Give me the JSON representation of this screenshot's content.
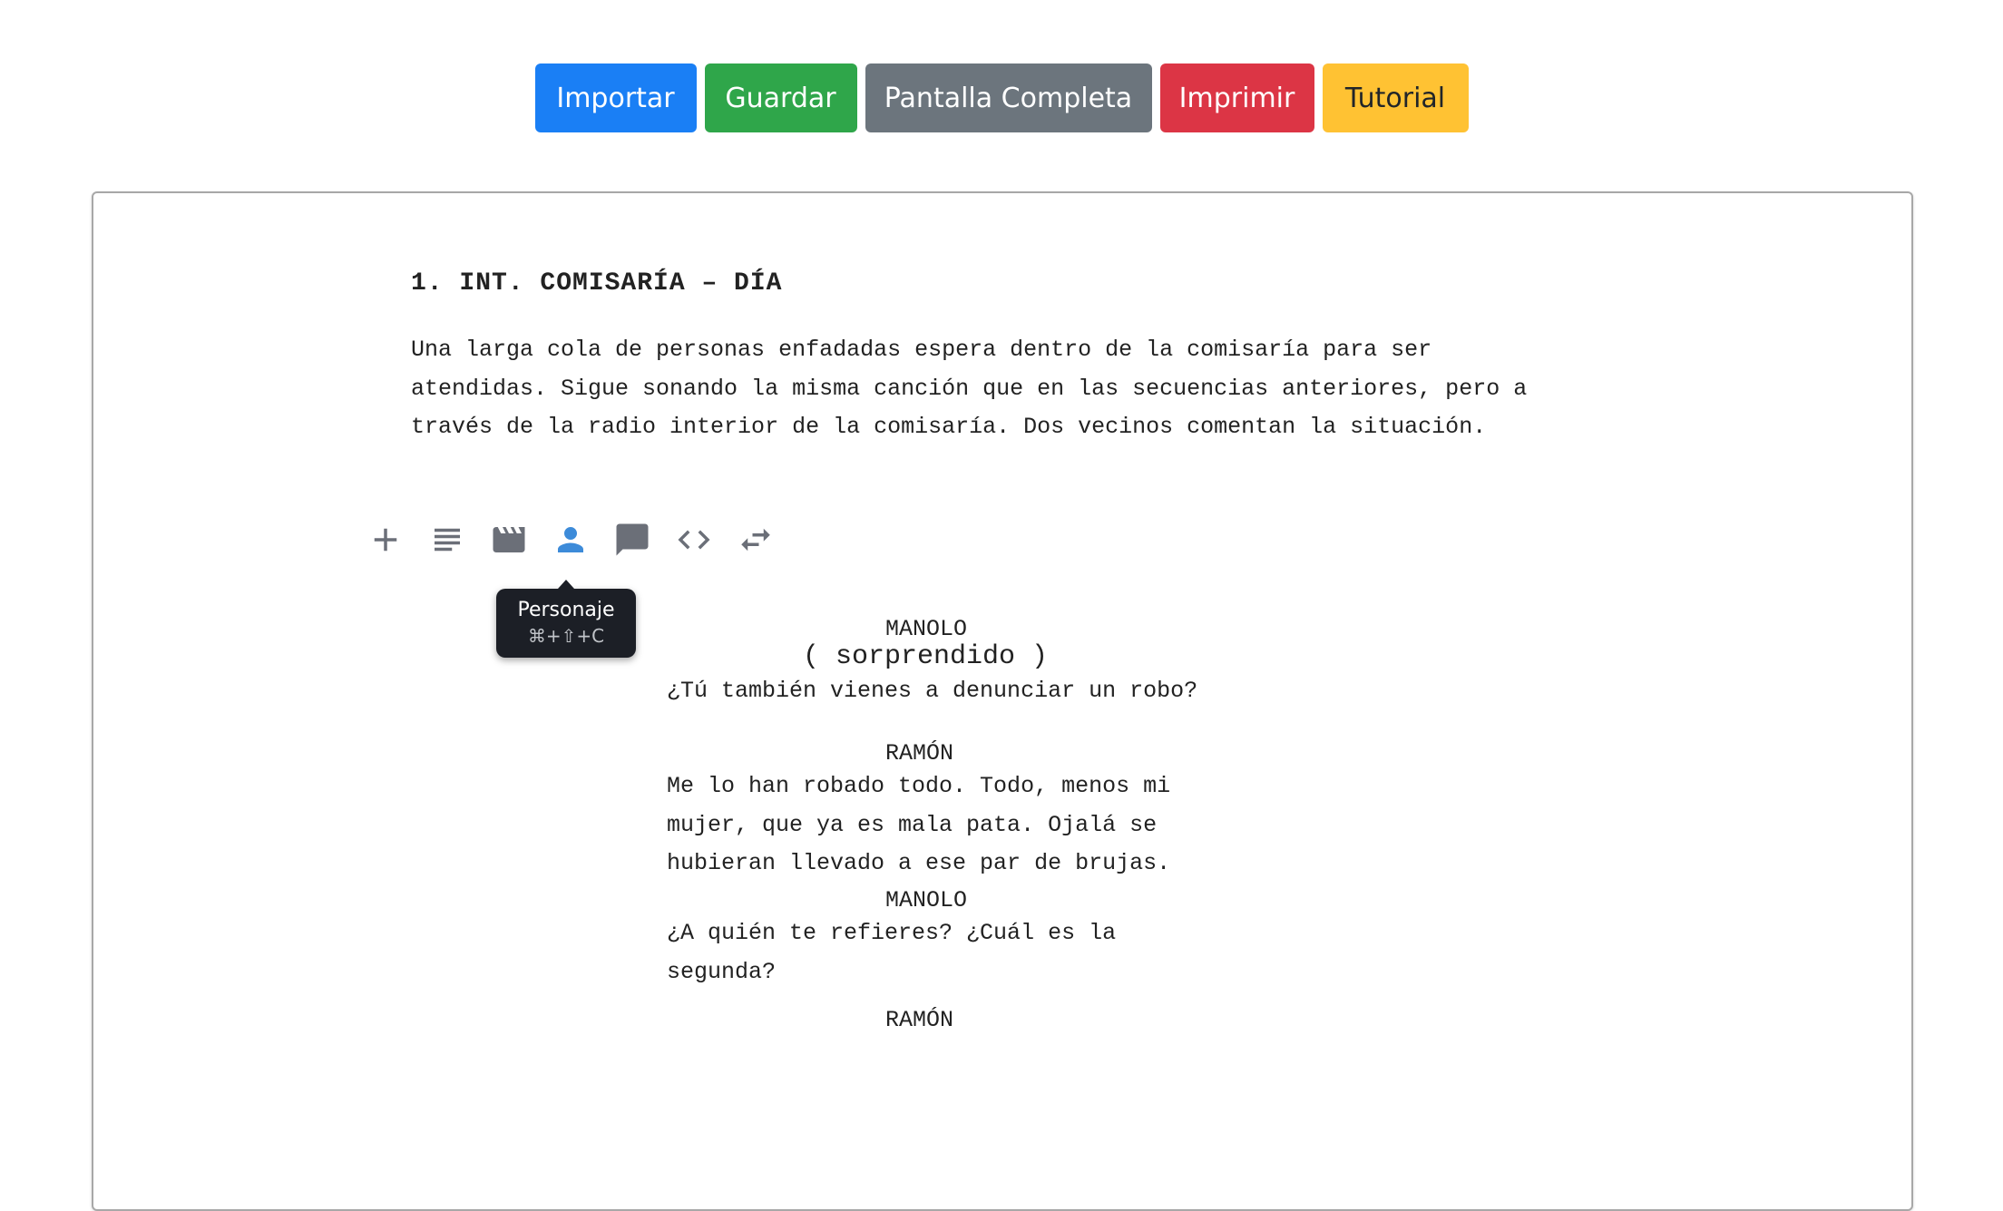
{
  "toolbar": {
    "import": "Importar",
    "save": "Guardar",
    "fullscreen": "Pantalla Completa",
    "print": "Imprimir",
    "tutorial": "Tutorial"
  },
  "script": {
    "scene_heading": "1. INT. COMISARÍA – DÍA",
    "action": "Una larga cola de personas enfadadas espera dentro de la comisaría para ser atendidas. Sigue sonando la misma canción que en las secuencias anteriores, pero a través de la radio interior de la comisaría. Dos vecinos comentan la situación.",
    "blocks": [
      {
        "character": "MANOLO",
        "parenthetical": "( sorprendido )",
        "dialogue": "¿Tú también vienes a denunciar un robo?"
      },
      {
        "character": "RAMÓN",
        "dialogue": "Me lo han robado todo. Todo, menos mi\nmujer, que ya es mala pata. Ojalá se\nhubieran llevado a ese par de brujas."
      },
      {
        "character": "MANOLO",
        "dialogue": "¿A quién te refieres? ¿Cuál es la\nsegunda?"
      },
      {
        "character": "RAMÓN"
      }
    ]
  },
  "element_toolbar": {
    "icons": [
      "plus-icon",
      "action-lines-icon",
      "clapperboard-icon",
      "person-icon",
      "speech-bubble-icon",
      "code-brackets-icon",
      "swap-arrows-icon"
    ],
    "active": "person-icon",
    "active_color": "#3d8bd9",
    "icon_color": "#6b6f78"
  },
  "tooltip": {
    "title": "Personaje",
    "shortcut": "⌘+⇧+C"
  }
}
